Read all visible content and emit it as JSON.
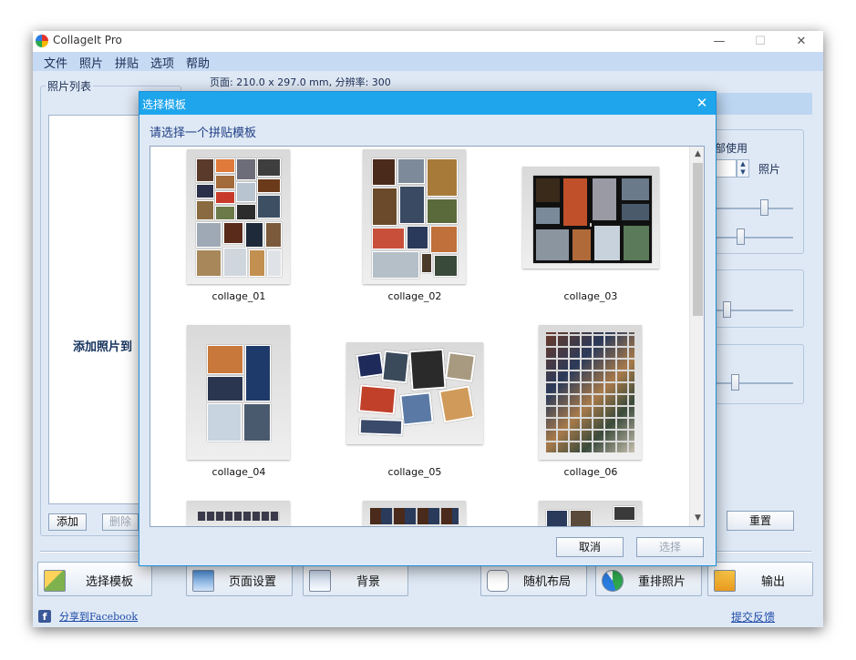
{
  "app": {
    "title": "CollageIt Pro",
    "window_controls": {
      "minimize": "—",
      "maximize": "☐",
      "close": "✕"
    }
  },
  "menu": [
    "文件",
    "照片",
    "拼贴",
    "选项",
    "帮助"
  ],
  "page_info": "页面: 210.0 x 297.0 mm, 分辨率: 300",
  "photo_list": {
    "legend": "照片列表",
    "hint": "添加照片到",
    "add_button": "添加",
    "delete_button": "删除"
  },
  "right_panel": {
    "use_label": "部使用",
    "photo_label": "照片",
    "reset_button": "重置"
  },
  "toolbar": {
    "select_template": "选择模板",
    "page_setup": "页面设置",
    "background": "背景",
    "random_layout": "随机布局",
    "rearrange": "重排照片",
    "output": "输出"
  },
  "footer": {
    "facebook_icon": "f",
    "facebook_link": "分享到Facebook",
    "feedback_link": "提交反馈"
  },
  "dialog": {
    "title": "选择模板",
    "close": "✕",
    "prompt": "请选择一个拼贴模板",
    "templates": [
      "collage_01",
      "collage_02",
      "collage_03",
      "collage_04",
      "collage_05",
      "collage_06"
    ],
    "scroll_up": "▲",
    "scroll_down": "▼",
    "cancel_button": "取消",
    "select_button": "选择"
  },
  "colors": {
    "dialog_title_bar": "#1ea5ec",
    "window_bg": "#dfe9f5",
    "menu_bar": "#c6daf4",
    "link": "#1e4aa8"
  }
}
